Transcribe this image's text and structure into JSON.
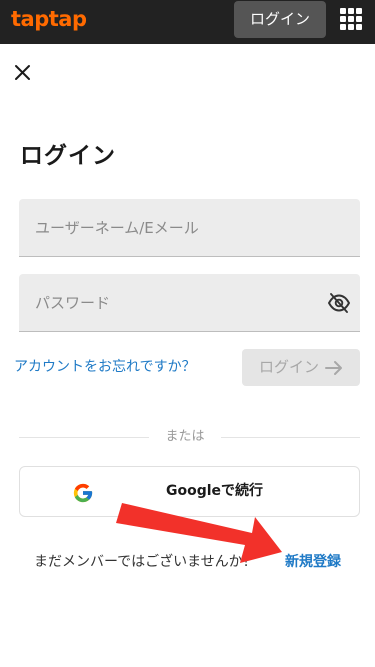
{
  "header": {
    "logo_text": "taptap",
    "logo_color": "#ff6a00",
    "login_label": "ログイン",
    "menu_icon": "apps-grid-icon"
  },
  "form": {
    "close_icon": "close-icon",
    "title": "ログイン",
    "username_placeholder": "ユーザーネーム/Eメール",
    "password_placeholder": "パスワード",
    "password_toggle_icon": "eye-off-icon",
    "forgot_label": "アカウントをお忘れですか？",
    "login_label": "ログイン",
    "login_icon": "arrow-right-icon"
  },
  "divider": {
    "text": "または"
  },
  "google": {
    "icon": "google-icon",
    "label": "Googleで続行"
  },
  "footer": {
    "prompt": "まだメンバーではございませんか？",
    "signup_label": "新規登録"
  },
  "annotation": {
    "arrow_icon": "red-arrow-icon",
    "color": "#f2312a"
  },
  "colors": {
    "topbar": "#222222",
    "link": "#1f7ac6",
    "field_bg": "#ececec",
    "disabled_button": "#e5e5e5"
  }
}
